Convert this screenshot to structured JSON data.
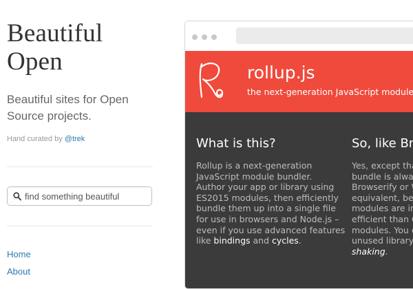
{
  "sidebar": {
    "title_line1": "Beautiful",
    "title_line2": "Open",
    "tagline": "Beautiful sites for Open Source projects.",
    "credit_prefix": "Hand curated by",
    "credit_link": "@trek",
    "search_placeholder": "find something beautiful",
    "nav": {
      "home": "Home",
      "about": "About"
    }
  },
  "preview": {
    "hero_title": "rollup.js",
    "hero_subtitle": "the next-generation JavaScript module",
    "col1": {
      "heading": "What is this?",
      "lines": [
        "Rollup is a next-generation",
        "JavaScript module bundler.",
        "Author your app or library using",
        "ES2015 modules, then efficiently",
        "bundle them up into a single file",
        "for use in browsers and Node.js –",
        "even if you use advanced features"
      ],
      "last_prefix": "like ",
      "last_link1": "bindings",
      "last_mid": " and ",
      "last_link2": "cycles",
      "last_suffix": "."
    },
    "col2": {
      "heading": "So, like Bro",
      "lines": [
        "Yes, except tha",
        "bundle is alwa",
        "Browserify or W",
        "equivalent, be",
        "modules are in",
        "efficient than C",
        "modules. You c",
        "unused library"
      ],
      "last_italic": "shaking",
      "last_suffix": "."
    }
  },
  "colors": {
    "hero": "#ef4a3c",
    "dark": "#3b3b3b",
    "link": "#2a7ab0"
  }
}
